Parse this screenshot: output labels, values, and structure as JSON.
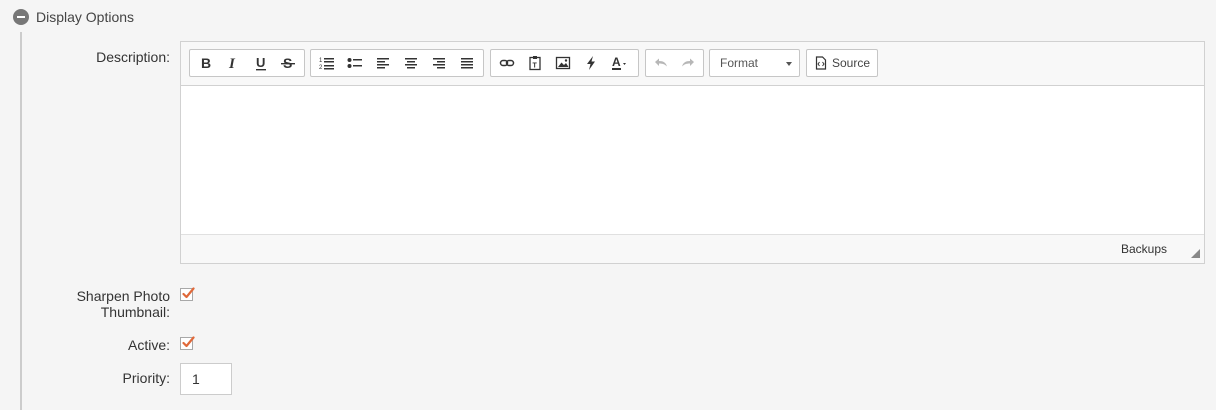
{
  "section": {
    "title": "Display Options",
    "icon": "minus-circle-icon"
  },
  "form": {
    "description_label": "Description:",
    "sharpen_label_line1": "Sharpen Photo",
    "sharpen_label_line2": "Thumbnail:",
    "sharpen_checked": true,
    "active_label": "Active:",
    "active_checked": true,
    "priority_label": "Priority:",
    "priority_value": "1"
  },
  "editor": {
    "toolbar": {
      "format_label": "Format",
      "source_label": "Source",
      "buttons": [
        "bold",
        "italic",
        "underline",
        "strikethrough",
        "numbered-list",
        "bulleted-list",
        "align-left",
        "align-center",
        "align-right",
        "justify",
        "link",
        "paste-text",
        "image",
        "lightning",
        "text-color",
        "undo",
        "redo"
      ]
    },
    "content": "",
    "footer_label": "Backups"
  },
  "colors": {
    "check_accent": "#e0693a",
    "collapse_icon": "#777777",
    "border": "#d1d1d1"
  }
}
